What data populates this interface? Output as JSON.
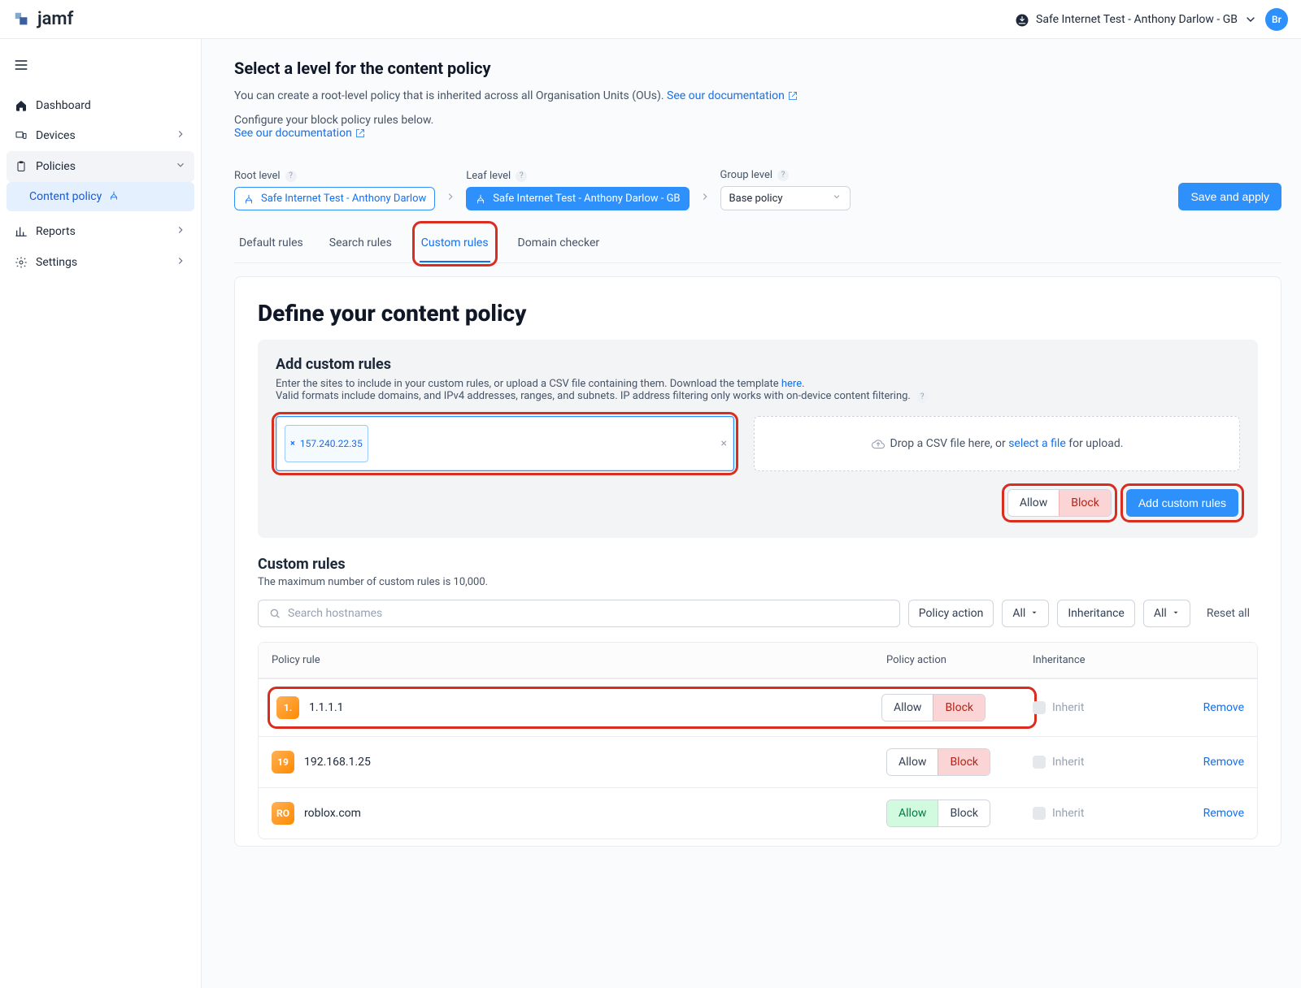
{
  "brand": {
    "name": "jamf"
  },
  "header": {
    "org_name": "Safe Internet Test - Anthony Darlow - GB",
    "avatar_initials": "Br"
  },
  "sidebar": {
    "items": [
      {
        "key": "dashboard",
        "label": "Dashboard",
        "icon": "home",
        "expandable": false
      },
      {
        "key": "devices",
        "label": "Devices",
        "icon": "devices",
        "expandable": true
      },
      {
        "key": "policies",
        "label": "Policies",
        "icon": "clipboard",
        "expandable": true,
        "active": true,
        "children": [
          {
            "key": "content-policy",
            "label": "Content policy",
            "icon": "tree",
            "active": true
          }
        ]
      },
      {
        "key": "reports",
        "label": "Reports",
        "icon": "chart",
        "expandable": true
      },
      {
        "key": "settings",
        "label": "Settings",
        "icon": "gear",
        "expandable": true
      }
    ]
  },
  "content": {
    "title": "Select a level for the content policy",
    "subtitle_prefix": "You can create a root-level policy that is inherited across all Organisation Units (OUs).",
    "doc_link_text": "See our documentation",
    "configure_prefix": "Configure your block policy rules below.",
    "doc_link2_text": "See our documentation"
  },
  "levels": {
    "root_label": "Root level",
    "leaf_label": "Leaf level",
    "group_label": "Group level",
    "root_value": "Safe Internet Test - Anthony Darlow",
    "leaf_value": "Safe Internet Test - Anthony Darlow - GB",
    "group_value": "Base policy",
    "save_label": "Save and apply"
  },
  "tabs": [
    {
      "key": "default",
      "label": "Default rules"
    },
    {
      "key": "search",
      "label": "Search rules"
    },
    {
      "key": "custom",
      "label": "Custom rules",
      "active": true
    },
    {
      "key": "checker",
      "label": "Domain checker"
    }
  ],
  "define": {
    "title": "Define your content policy",
    "add_title": "Add custom rules",
    "add_sub_1": "Enter the sites to include in your custom rules, or upload a CSV file containing them. Download the template ",
    "add_sub_here": "here",
    "add_sub_2": "Valid formats include domains, and IPv4 addresses, ranges, and subnets. IP address filtering only works with on-device content filtering.",
    "token_value": "157.240.22.35",
    "dropzone_prefix": "Drop a CSV file here, or ",
    "dropzone_link": "select a file",
    "dropzone_suffix": " for upload.",
    "allow_label": "Allow",
    "block_label": "Block",
    "add_btn_label": "Add custom rules"
  },
  "custom_rules": {
    "title": "Custom rules",
    "subtitle": "The maximum number of custom rules is 10,000.",
    "search_placeholder": "Search hostnames",
    "policy_action_label": "Policy action",
    "all_label": "All",
    "inheritance_label": "Inheritance",
    "reset_label": "Reset all",
    "columns": {
      "rule": "Policy rule",
      "action": "Policy action",
      "inheritance": "Inheritance"
    },
    "inherit_label": "Inherit",
    "remove_label": "Remove",
    "rows": [
      {
        "badge": "1.",
        "host": "1.1.1.1",
        "action": "block",
        "highlighted": true
      },
      {
        "badge": "19",
        "host": "192.168.1.25",
        "action": "block"
      },
      {
        "badge": "RO",
        "host": "roblox.com",
        "action": "allow"
      }
    ]
  }
}
